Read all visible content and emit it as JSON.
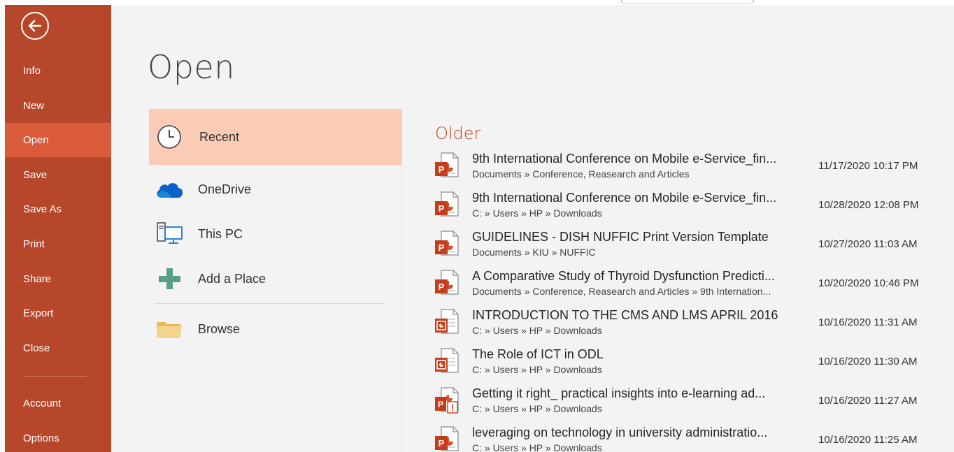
{
  "nav": {
    "items": [
      {
        "label": "Info"
      },
      {
        "label": "New"
      },
      {
        "label": "Open"
      },
      {
        "label": "Save"
      },
      {
        "label": "Save As"
      },
      {
        "label": "Print"
      },
      {
        "label": "Share"
      },
      {
        "label": "Export"
      },
      {
        "label": "Close"
      },
      {
        "label": "Account"
      },
      {
        "label": "Options"
      }
    ],
    "active": "Open"
  },
  "page": {
    "title": "Open"
  },
  "locations": [
    {
      "label": "Recent",
      "icon": "clock-icon"
    },
    {
      "label": "OneDrive",
      "icon": "cloud-icon"
    },
    {
      "label": "This PC",
      "icon": "computer-icon"
    },
    {
      "label": "Add a Place",
      "icon": "plus-icon"
    },
    {
      "label": "Browse",
      "icon": "folder-icon"
    }
  ],
  "recent": {
    "group_heading": "Older",
    "files": [
      {
        "name": "9th International Conference on Mobile e-Service_fin...",
        "path": "Documents » Conference, Reasearch and Articles",
        "date": "11/17/2020 10:17 PM",
        "icon": "pptx-icon"
      },
      {
        "name": "9th International Conference on Mobile e-Service_fin...",
        "path": "C: » Users » HP » Downloads",
        "date": "10/28/2020 12:08 PM",
        "icon": "pptx-icon"
      },
      {
        "name": "GUIDELINES - DISH NUFFIC Print Version Template",
        "path": "Documents » KIU » NUFFIC",
        "date": "10/27/2020 11:03 AM",
        "icon": "pptx-icon"
      },
      {
        "name": "A Comparative Study of Thyroid Dysfunction Predicti...",
        "path": "Documents » Conference, Reasearch and Articles » 9th Internation...",
        "date": "10/20/2020 10:46 PM",
        "icon": "pptx-icon"
      },
      {
        "name": "INTRODUCTION TO THE CMS AND LMS APRIL 2016",
        "path": "C: » Users » HP » Downloads",
        "date": "10/16/2020 11:31 AM",
        "icon": "ppt-legacy-icon"
      },
      {
        "name": "The Role of ICT in ODL",
        "path": "C: » Users » HP » Downloads",
        "date": "10/16/2020 11:30 AM",
        "icon": "ppt-legacy-icon"
      },
      {
        "name": "Getting it right_ practical insights into e-learning ad...",
        "path": "C: » Users » HP » Downloads",
        "date": "10/16/2020 11:27 AM",
        "icon": "ppt-warning-icon"
      },
      {
        "name": "leveraging on technology in university administratio...",
        "path": "C: » Users » HP » Downloads",
        "date": "10/16/2020 11:25 AM",
        "icon": "pptx-icon"
      }
    ]
  },
  "colors": {
    "nav_bg": "#b7472a",
    "nav_active": "#da5b3c",
    "location_active": "#fbcbb6",
    "heading_accent": "#c43e1c"
  }
}
